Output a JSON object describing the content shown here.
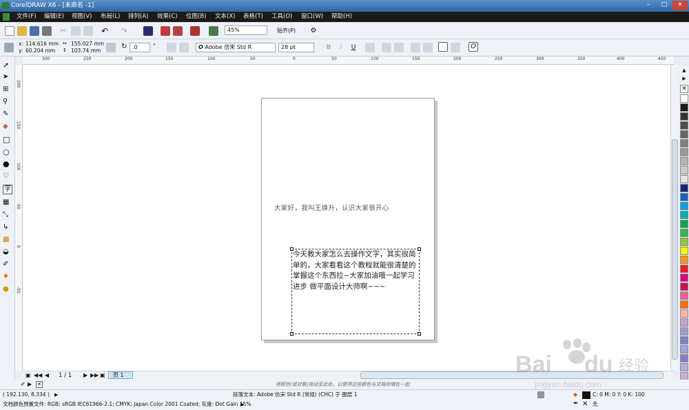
{
  "window": {
    "title": "CorelDRAW X6 - [未命名 -1]"
  },
  "menu": [
    "文件(F)",
    "编辑(E)",
    "视图(V)",
    "布局(L)",
    "排列(A)",
    "效果(C)",
    "位图(B)",
    "文本(X)",
    "表格(T)",
    "工具(O)",
    "窗口(W)",
    "帮助(H)"
  ],
  "toolbar1": {
    "zoom": "45%",
    "snap_label": "贴齐(P)"
  },
  "toolbar2": {
    "x_label": "x:",
    "x": "114.616 mm",
    "y_label": "y:",
    "y": "60.204 mm",
    "w": "155.027 mm",
    "h": "103.74 mm",
    "rotation": ".0",
    "degree": "°",
    "font": "Adobe 仿宋 Std R",
    "font_size": "28 pt"
  },
  "ruler": {
    "h_ticks": [
      "300",
      "250",
      "200",
      "150",
      "100",
      "50",
      "0",
      "50",
      "100",
      "150",
      "200",
      "250",
      "300",
      "350",
      "400",
      "450"
    ],
    "v_ticks": [
      "200",
      "150",
      "100",
      "50",
      "0",
      "-50"
    ]
  },
  "document": {
    "heading": "大家好，我叫王焕升，认识大家很开心",
    "body": "今天教大家怎么去操作文字，其实很简单的，大家看看这个教程就能很清楚的掌握这个东西拉~大家加油哦一起学习进步 做平面设计大师啊~~~"
  },
  "pagenav": {
    "count": "1 / 1",
    "tab": "页 1"
  },
  "hint": "将颜色(或对象)拖动至此处，以便将这些颜色与文档存储在一起",
  "status": {
    "coords": "( 192.130, 8.334 )",
    "object": "段落文本: Adobe 仿宋 Std R (常规) (CHC) 于 图层 1",
    "fill": "C: 0 M: 0 Y: 0 K: 100",
    "outline": "无",
    "profile": "文档颜色预置文件: RGB: sRGB IEC61966-2.1; CMYK: Japan Color 2001 Coated; 灰度: Dot Gain 15%"
  },
  "palette": [
    "#ffffff",
    "#1a1a1a",
    "#333333",
    "#4d4d4d",
    "#666666",
    "#808080",
    "#999999",
    "#b3b3b3",
    "#cccccc",
    "#e6e6e6",
    "#1a237e",
    "#1565c0",
    "#00a0e9",
    "#00b0b0",
    "#00a651",
    "#39b54a",
    "#8dc63f",
    "#fff200",
    "#f7941d",
    "#ed1c24",
    "#e4007f",
    "#c2185b",
    "#f06292",
    "#ff6f00",
    "#ffb3a7",
    "#c8a2c8",
    "#9c9cce",
    "#7986cb",
    "#a3a3e0",
    "#8e7cc3",
    "#b0b0d8",
    "#c5b0d5"
  ]
}
